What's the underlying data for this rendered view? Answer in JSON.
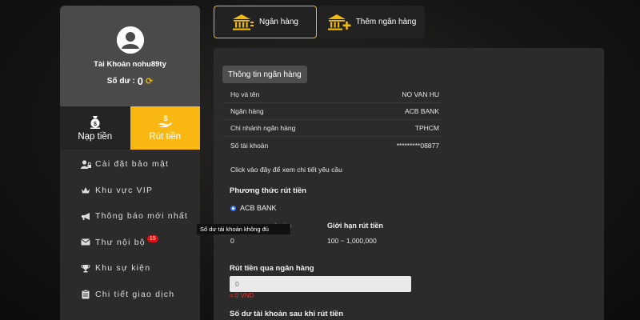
{
  "profile": {
    "account_name": "Tài Khoản nohu89ty",
    "balance_label": "Số dư :",
    "balance_value": "0"
  },
  "sidebar": {
    "tabs": [
      {
        "label": "Nạp tiền"
      },
      {
        "label": "Rút tiền"
      }
    ],
    "menu": [
      {
        "label": "Cài đặt bảo mật",
        "icon": "user-lock-icon"
      },
      {
        "label": "Khu vực VIP",
        "icon": "crown-icon"
      },
      {
        "label": "Thông báo mới nhất",
        "icon": "megaphone-icon"
      },
      {
        "label": "Thư nội bộ",
        "icon": "envelope-icon",
        "badge": "15"
      },
      {
        "label": "Khu sự kiện",
        "icon": "trophy-icon"
      },
      {
        "label": "Chi tiết giao dịch",
        "icon": "clipboard-icon"
      }
    ]
  },
  "bank_tabs": [
    {
      "label": "Ngân hàng"
    },
    {
      "label": "Thêm ngân hàng"
    }
  ],
  "bank_info": {
    "header": "Thông tin ngân hàng",
    "rows": [
      {
        "label": "Họ và tên",
        "value": "NO VAN HU"
      },
      {
        "label": "Ngân hàng",
        "value": "ACB BANK"
      },
      {
        "label": "Chi nhánh ngân hàng",
        "value": "TPHCM"
      },
      {
        "label": "Số tài khoản",
        "value": "*********08877"
      }
    ],
    "detail_link": "Click vào đây để xem chi tiết yêu cầu"
  },
  "withdraw": {
    "method_title": "Phương thức rút tiền",
    "method_option": "ACB BANK",
    "balance_label_visible": "hoản",
    "balance_value": "0",
    "limit_label": "Giới hạn rút tiền",
    "limit_value": "100 ~ 1,000,000",
    "bank_withdraw_title": "Rút tiền qua ngân hàng",
    "amount_placeholder": "0",
    "amount_vnd": "= 0 VND",
    "after_title": "Số dư tài khoản sau khi rút tiền"
  },
  "tooltip": "Số dư tài khoản không đủ",
  "colors": {
    "accent": "#f8b811",
    "panel": "#2b2b2b",
    "profile_bg": "#4a4a4a",
    "error": "#d23c3c",
    "badge": "#dd1111"
  }
}
